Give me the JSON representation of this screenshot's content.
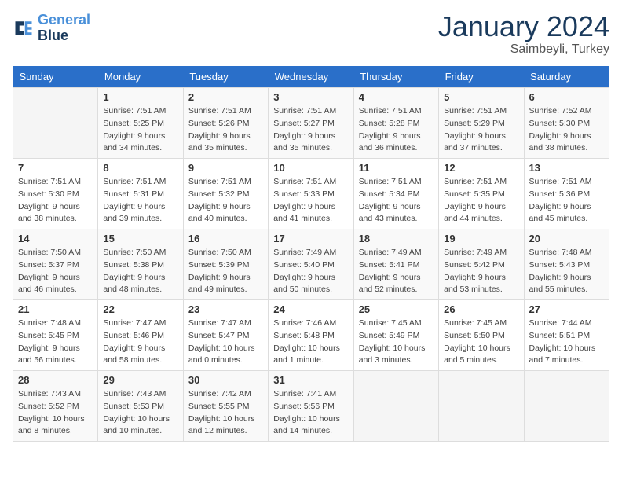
{
  "logo": {
    "line1": "General",
    "line2": "Blue"
  },
  "title": "January 2024",
  "location": "Saimbeyli, Turkey",
  "days_header": [
    "Sunday",
    "Monday",
    "Tuesday",
    "Wednesday",
    "Thursday",
    "Friday",
    "Saturday"
  ],
  "weeks": [
    [
      {
        "day": "",
        "info": ""
      },
      {
        "day": "1",
        "info": "Sunrise: 7:51 AM\nSunset: 5:25 PM\nDaylight: 9 hours\nand 34 minutes."
      },
      {
        "day": "2",
        "info": "Sunrise: 7:51 AM\nSunset: 5:26 PM\nDaylight: 9 hours\nand 35 minutes."
      },
      {
        "day": "3",
        "info": "Sunrise: 7:51 AM\nSunset: 5:27 PM\nDaylight: 9 hours\nand 35 minutes."
      },
      {
        "day": "4",
        "info": "Sunrise: 7:51 AM\nSunset: 5:28 PM\nDaylight: 9 hours\nand 36 minutes."
      },
      {
        "day": "5",
        "info": "Sunrise: 7:51 AM\nSunset: 5:29 PM\nDaylight: 9 hours\nand 37 minutes."
      },
      {
        "day": "6",
        "info": "Sunrise: 7:52 AM\nSunset: 5:30 PM\nDaylight: 9 hours\nand 38 minutes."
      }
    ],
    [
      {
        "day": "7",
        "info": "Sunrise: 7:51 AM\nSunset: 5:30 PM\nDaylight: 9 hours\nand 38 minutes."
      },
      {
        "day": "8",
        "info": "Sunrise: 7:51 AM\nSunset: 5:31 PM\nDaylight: 9 hours\nand 39 minutes."
      },
      {
        "day": "9",
        "info": "Sunrise: 7:51 AM\nSunset: 5:32 PM\nDaylight: 9 hours\nand 40 minutes."
      },
      {
        "day": "10",
        "info": "Sunrise: 7:51 AM\nSunset: 5:33 PM\nDaylight: 9 hours\nand 41 minutes."
      },
      {
        "day": "11",
        "info": "Sunrise: 7:51 AM\nSunset: 5:34 PM\nDaylight: 9 hours\nand 43 minutes."
      },
      {
        "day": "12",
        "info": "Sunrise: 7:51 AM\nSunset: 5:35 PM\nDaylight: 9 hours\nand 44 minutes."
      },
      {
        "day": "13",
        "info": "Sunrise: 7:51 AM\nSunset: 5:36 PM\nDaylight: 9 hours\nand 45 minutes."
      }
    ],
    [
      {
        "day": "14",
        "info": "Sunrise: 7:50 AM\nSunset: 5:37 PM\nDaylight: 9 hours\nand 46 minutes."
      },
      {
        "day": "15",
        "info": "Sunrise: 7:50 AM\nSunset: 5:38 PM\nDaylight: 9 hours\nand 48 minutes."
      },
      {
        "day": "16",
        "info": "Sunrise: 7:50 AM\nSunset: 5:39 PM\nDaylight: 9 hours\nand 49 minutes."
      },
      {
        "day": "17",
        "info": "Sunrise: 7:49 AM\nSunset: 5:40 PM\nDaylight: 9 hours\nand 50 minutes."
      },
      {
        "day": "18",
        "info": "Sunrise: 7:49 AM\nSunset: 5:41 PM\nDaylight: 9 hours\nand 52 minutes."
      },
      {
        "day": "19",
        "info": "Sunrise: 7:49 AM\nSunset: 5:42 PM\nDaylight: 9 hours\nand 53 minutes."
      },
      {
        "day": "20",
        "info": "Sunrise: 7:48 AM\nSunset: 5:43 PM\nDaylight: 9 hours\nand 55 minutes."
      }
    ],
    [
      {
        "day": "21",
        "info": "Sunrise: 7:48 AM\nSunset: 5:45 PM\nDaylight: 9 hours\nand 56 minutes."
      },
      {
        "day": "22",
        "info": "Sunrise: 7:47 AM\nSunset: 5:46 PM\nDaylight: 9 hours\nand 58 minutes."
      },
      {
        "day": "23",
        "info": "Sunrise: 7:47 AM\nSunset: 5:47 PM\nDaylight: 10 hours\nand 0 minutes."
      },
      {
        "day": "24",
        "info": "Sunrise: 7:46 AM\nSunset: 5:48 PM\nDaylight: 10 hours\nand 1 minute."
      },
      {
        "day": "25",
        "info": "Sunrise: 7:45 AM\nSunset: 5:49 PM\nDaylight: 10 hours\nand 3 minutes."
      },
      {
        "day": "26",
        "info": "Sunrise: 7:45 AM\nSunset: 5:50 PM\nDaylight: 10 hours\nand 5 minutes."
      },
      {
        "day": "27",
        "info": "Sunrise: 7:44 AM\nSunset: 5:51 PM\nDaylight: 10 hours\nand 7 minutes."
      }
    ],
    [
      {
        "day": "28",
        "info": "Sunrise: 7:43 AM\nSunset: 5:52 PM\nDaylight: 10 hours\nand 8 minutes."
      },
      {
        "day": "29",
        "info": "Sunrise: 7:43 AM\nSunset: 5:53 PM\nDaylight: 10 hours\nand 10 minutes."
      },
      {
        "day": "30",
        "info": "Sunrise: 7:42 AM\nSunset: 5:55 PM\nDaylight: 10 hours\nand 12 minutes."
      },
      {
        "day": "31",
        "info": "Sunrise: 7:41 AM\nSunset: 5:56 PM\nDaylight: 10 hours\nand 14 minutes."
      },
      {
        "day": "",
        "info": ""
      },
      {
        "day": "",
        "info": ""
      },
      {
        "day": "",
        "info": ""
      }
    ]
  ]
}
